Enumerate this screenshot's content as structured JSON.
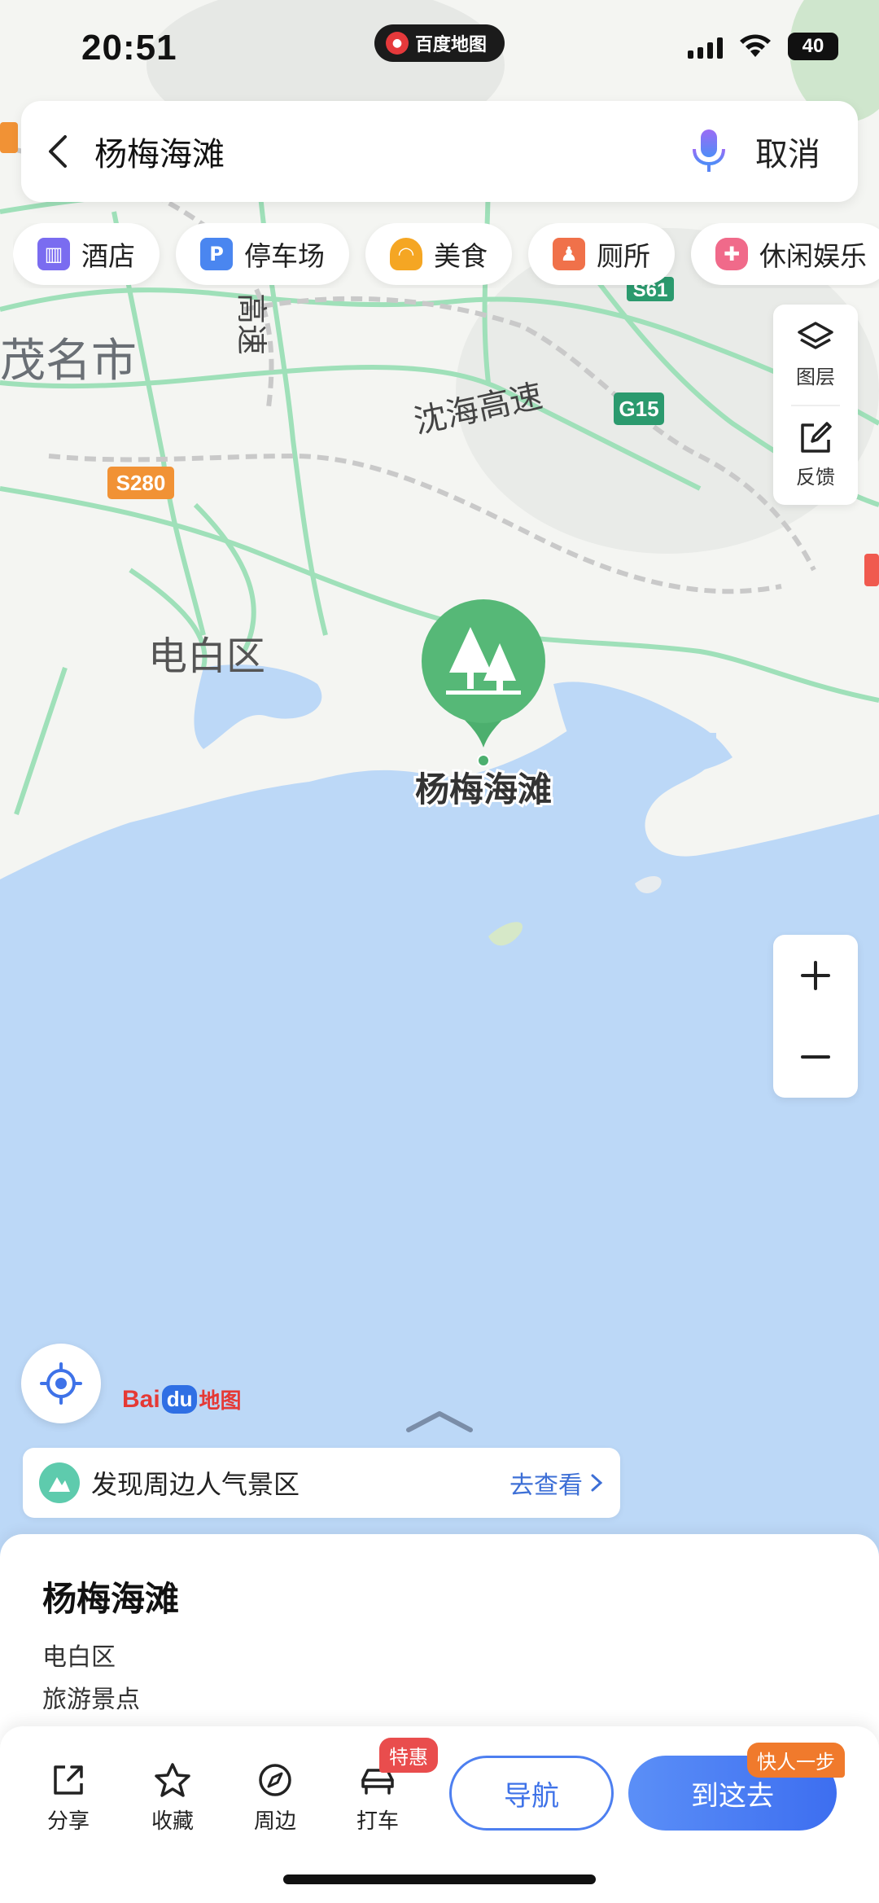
{
  "status_bar": {
    "time": "20:51",
    "app_pill_label": "百度地图",
    "battery": "40"
  },
  "search": {
    "query": "杨梅海滩",
    "cancel_label": "取消"
  },
  "chips": [
    {
      "label": "酒店",
      "icon": "hotel-icon",
      "color": "#7a6cf0"
    },
    {
      "label": "停车场",
      "icon": "parking-icon",
      "color": "#4a86f0"
    },
    {
      "label": "美食",
      "icon": "food-icon",
      "color": "#f5a623"
    },
    {
      "label": "厕所",
      "icon": "toilet-icon",
      "color": "#f0714a"
    },
    {
      "label": "休闲娱乐",
      "icon": "game-icon",
      "color": "#f06a8a"
    }
  ],
  "tools": {
    "layers_label": "图层",
    "feedback_label": "反馈"
  },
  "map": {
    "labels": {
      "city": "茂名市",
      "district": "电白区",
      "highway": "沈海高速",
      "vertical_highway": "高速",
      "place": "杨梅海滩"
    },
    "shields": {
      "s280": "S280",
      "g15": "G15",
      "s61": "S61"
    },
    "accent": "#4caf6e",
    "sea": "#bcd8f7"
  },
  "baidu_logo": {
    "bai": "Bai",
    "du": "du",
    "map": "地图"
  },
  "discover": {
    "text": "发现周边人气景区",
    "link": "去查看"
  },
  "place": {
    "name": "杨梅海滩",
    "district": "电白区",
    "category": "旅游景点"
  },
  "actions": {
    "share": "分享",
    "favorite": "收藏",
    "nearby": "周边",
    "taxi": "打车",
    "deal_badge": "特惠",
    "navigate": "导航",
    "go_here": "到这去",
    "fast_badge": "快人一步"
  }
}
